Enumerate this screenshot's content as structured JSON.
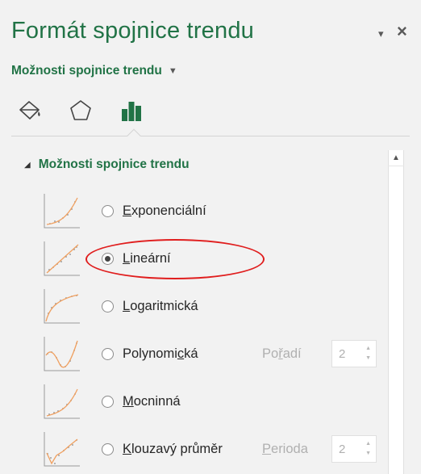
{
  "pane": {
    "title": "Formát spojnice trendu",
    "menu_glyph": "▾",
    "close_glyph": "×",
    "section_dropdown": {
      "label": "Možnosti spojnice trendu",
      "caret": "▼"
    }
  },
  "category_tabs": [
    {
      "icon": "fill-bucket-icon",
      "selected": false
    },
    {
      "icon": "pentagon-effects-icon",
      "selected": false
    },
    {
      "icon": "bar-chart-options-icon",
      "selected": true
    }
  ],
  "group": {
    "title": "Možnosti spojnice trendu",
    "expanded": true
  },
  "trend_options": [
    {
      "icon": "exponential-trend-icon",
      "label_pre": "",
      "label_ul": "E",
      "label_post": "xponenciální",
      "checked": false
    },
    {
      "icon": "linear-trend-icon",
      "label_pre": "",
      "label_ul": "L",
      "label_post": "ineární",
      "checked": true
    },
    {
      "icon": "logarithmic-trend-icon",
      "label_pre": "",
      "label_ul": "L",
      "label_post": "ogaritmická",
      "checked": false
    },
    {
      "icon": "polynomial-trend-icon",
      "label_pre": "Polynomi",
      "label_ul": "c",
      "label_post": "ká",
      "checked": false,
      "param": {
        "pre": "Po",
        "ul": "ř",
        "post": "adí",
        "value": "2"
      }
    },
    {
      "icon": "power-trend-icon",
      "label_pre": "",
      "label_ul": "M",
      "label_post": "ocninná",
      "checked": false
    },
    {
      "icon": "moving-average-trend-icon",
      "label_pre": "",
      "label_ul": "K",
      "label_post": "louzavý průměr",
      "checked": false,
      "param": {
        "pre": "",
        "ul": "P",
        "post": "erioda",
        "value": "2"
      }
    }
  ],
  "colors": {
    "accent": "#217346",
    "highlight": "#e01e1e",
    "trend_line": "#f0a060",
    "disabled": "#b0b0b0"
  }
}
